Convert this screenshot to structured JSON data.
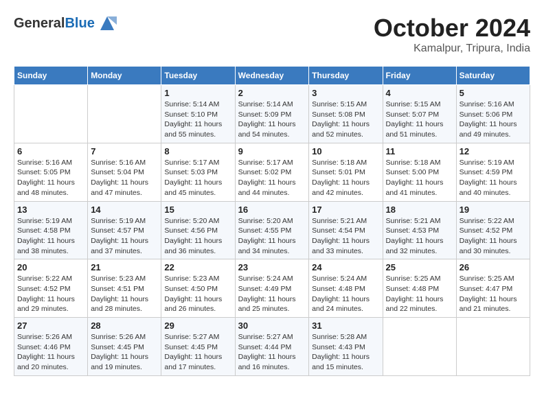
{
  "header": {
    "logo_general": "General",
    "logo_blue": "Blue",
    "title": "October 2024",
    "subtitle": "Kamalpur, Tripura, India"
  },
  "days_of_week": [
    "Sunday",
    "Monday",
    "Tuesday",
    "Wednesday",
    "Thursday",
    "Friday",
    "Saturday"
  ],
  "weeks": [
    [
      {
        "day": "",
        "sunrise": "",
        "sunset": "",
        "daylight": ""
      },
      {
        "day": "",
        "sunrise": "",
        "sunset": "",
        "daylight": ""
      },
      {
        "day": "1",
        "sunrise": "Sunrise: 5:14 AM",
        "sunset": "Sunset: 5:10 PM",
        "daylight": "Daylight: 11 hours and 55 minutes."
      },
      {
        "day": "2",
        "sunrise": "Sunrise: 5:14 AM",
        "sunset": "Sunset: 5:09 PM",
        "daylight": "Daylight: 11 hours and 54 minutes."
      },
      {
        "day": "3",
        "sunrise": "Sunrise: 5:15 AM",
        "sunset": "Sunset: 5:08 PM",
        "daylight": "Daylight: 11 hours and 52 minutes."
      },
      {
        "day": "4",
        "sunrise": "Sunrise: 5:15 AM",
        "sunset": "Sunset: 5:07 PM",
        "daylight": "Daylight: 11 hours and 51 minutes."
      },
      {
        "day": "5",
        "sunrise": "Sunrise: 5:16 AM",
        "sunset": "Sunset: 5:06 PM",
        "daylight": "Daylight: 11 hours and 49 minutes."
      }
    ],
    [
      {
        "day": "6",
        "sunrise": "Sunrise: 5:16 AM",
        "sunset": "Sunset: 5:05 PM",
        "daylight": "Daylight: 11 hours and 48 minutes."
      },
      {
        "day": "7",
        "sunrise": "Sunrise: 5:16 AM",
        "sunset": "Sunset: 5:04 PM",
        "daylight": "Daylight: 11 hours and 47 minutes."
      },
      {
        "day": "8",
        "sunrise": "Sunrise: 5:17 AM",
        "sunset": "Sunset: 5:03 PM",
        "daylight": "Daylight: 11 hours and 45 minutes."
      },
      {
        "day": "9",
        "sunrise": "Sunrise: 5:17 AM",
        "sunset": "Sunset: 5:02 PM",
        "daylight": "Daylight: 11 hours and 44 minutes."
      },
      {
        "day": "10",
        "sunrise": "Sunrise: 5:18 AM",
        "sunset": "Sunset: 5:01 PM",
        "daylight": "Daylight: 11 hours and 42 minutes."
      },
      {
        "day": "11",
        "sunrise": "Sunrise: 5:18 AM",
        "sunset": "Sunset: 5:00 PM",
        "daylight": "Daylight: 11 hours and 41 minutes."
      },
      {
        "day": "12",
        "sunrise": "Sunrise: 5:19 AM",
        "sunset": "Sunset: 4:59 PM",
        "daylight": "Daylight: 11 hours and 40 minutes."
      }
    ],
    [
      {
        "day": "13",
        "sunrise": "Sunrise: 5:19 AM",
        "sunset": "Sunset: 4:58 PM",
        "daylight": "Daylight: 11 hours and 38 minutes."
      },
      {
        "day": "14",
        "sunrise": "Sunrise: 5:19 AM",
        "sunset": "Sunset: 4:57 PM",
        "daylight": "Daylight: 11 hours and 37 minutes."
      },
      {
        "day": "15",
        "sunrise": "Sunrise: 5:20 AM",
        "sunset": "Sunset: 4:56 PM",
        "daylight": "Daylight: 11 hours and 36 minutes."
      },
      {
        "day": "16",
        "sunrise": "Sunrise: 5:20 AM",
        "sunset": "Sunset: 4:55 PM",
        "daylight": "Daylight: 11 hours and 34 minutes."
      },
      {
        "day": "17",
        "sunrise": "Sunrise: 5:21 AM",
        "sunset": "Sunset: 4:54 PM",
        "daylight": "Daylight: 11 hours and 33 minutes."
      },
      {
        "day": "18",
        "sunrise": "Sunrise: 5:21 AM",
        "sunset": "Sunset: 4:53 PM",
        "daylight": "Daylight: 11 hours and 32 minutes."
      },
      {
        "day": "19",
        "sunrise": "Sunrise: 5:22 AM",
        "sunset": "Sunset: 4:52 PM",
        "daylight": "Daylight: 11 hours and 30 minutes."
      }
    ],
    [
      {
        "day": "20",
        "sunrise": "Sunrise: 5:22 AM",
        "sunset": "Sunset: 4:52 PM",
        "daylight": "Daylight: 11 hours and 29 minutes."
      },
      {
        "day": "21",
        "sunrise": "Sunrise: 5:23 AM",
        "sunset": "Sunset: 4:51 PM",
        "daylight": "Daylight: 11 hours and 28 minutes."
      },
      {
        "day": "22",
        "sunrise": "Sunrise: 5:23 AM",
        "sunset": "Sunset: 4:50 PM",
        "daylight": "Daylight: 11 hours and 26 minutes."
      },
      {
        "day": "23",
        "sunrise": "Sunrise: 5:24 AM",
        "sunset": "Sunset: 4:49 PM",
        "daylight": "Daylight: 11 hours and 25 minutes."
      },
      {
        "day": "24",
        "sunrise": "Sunrise: 5:24 AM",
        "sunset": "Sunset: 4:48 PM",
        "daylight": "Daylight: 11 hours and 24 minutes."
      },
      {
        "day": "25",
        "sunrise": "Sunrise: 5:25 AM",
        "sunset": "Sunset: 4:48 PM",
        "daylight": "Daylight: 11 hours and 22 minutes."
      },
      {
        "day": "26",
        "sunrise": "Sunrise: 5:25 AM",
        "sunset": "Sunset: 4:47 PM",
        "daylight": "Daylight: 11 hours and 21 minutes."
      }
    ],
    [
      {
        "day": "27",
        "sunrise": "Sunrise: 5:26 AM",
        "sunset": "Sunset: 4:46 PM",
        "daylight": "Daylight: 11 hours and 20 minutes."
      },
      {
        "day": "28",
        "sunrise": "Sunrise: 5:26 AM",
        "sunset": "Sunset: 4:45 PM",
        "daylight": "Daylight: 11 hours and 19 minutes."
      },
      {
        "day": "29",
        "sunrise": "Sunrise: 5:27 AM",
        "sunset": "Sunset: 4:45 PM",
        "daylight": "Daylight: 11 hours and 17 minutes."
      },
      {
        "day": "30",
        "sunrise": "Sunrise: 5:27 AM",
        "sunset": "Sunset: 4:44 PM",
        "daylight": "Daylight: 11 hours and 16 minutes."
      },
      {
        "day": "31",
        "sunrise": "Sunrise: 5:28 AM",
        "sunset": "Sunset: 4:43 PM",
        "daylight": "Daylight: 11 hours and 15 minutes."
      },
      {
        "day": "",
        "sunrise": "",
        "sunset": "",
        "daylight": ""
      },
      {
        "day": "",
        "sunrise": "",
        "sunset": "",
        "daylight": ""
      }
    ]
  ]
}
